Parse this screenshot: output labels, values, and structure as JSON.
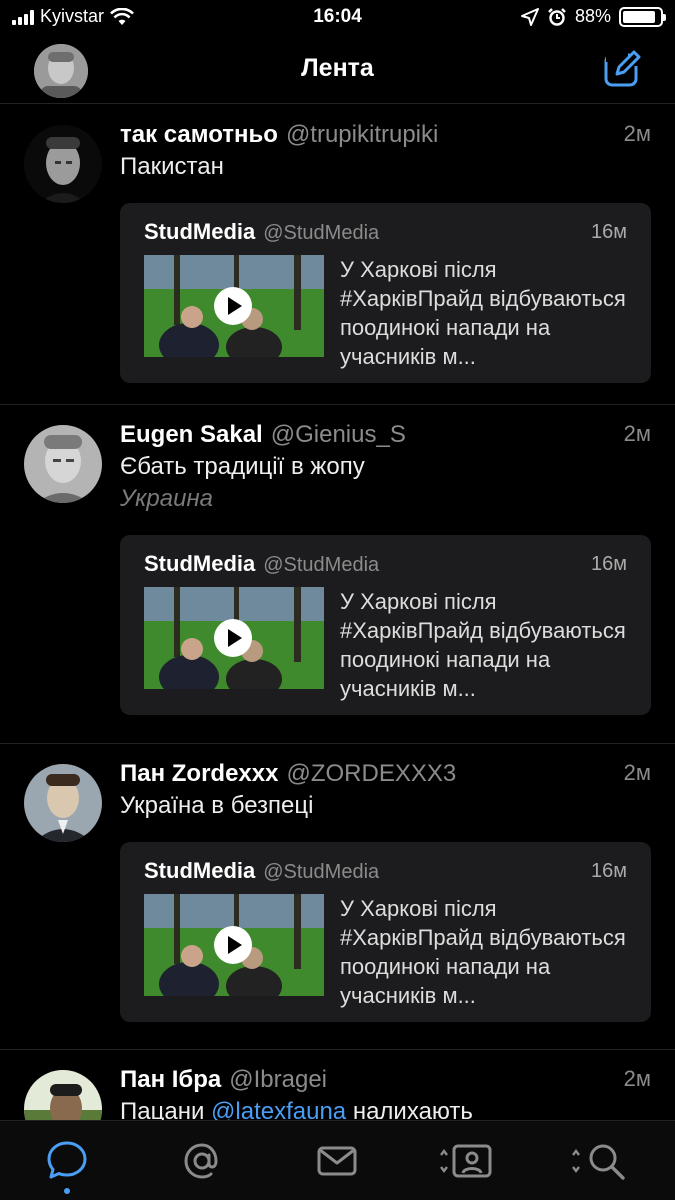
{
  "status_bar": {
    "carrier": "Kyivstar",
    "time": "16:04",
    "battery": "88%",
    "battery_level": 0.88
  },
  "nav": {
    "title": "Лента"
  },
  "tweets": [
    {
      "name": "так самотньо",
      "handle": "@trupikitrupiki",
      "time": "2м",
      "text": "Пакистан",
      "quote": {
        "name": "StudMedia",
        "handle": "@StudMedia",
        "time": "16м",
        "text": "У Харкові після #ХарківПрайд відбуваються поодинокі напади на учасників м..."
      }
    },
    {
      "name": "Eugen Sakal",
      "handle": "@Gienius_S",
      "time": "2м",
      "text": "Єбать традиції в жопу",
      "location": "Украина",
      "quote": {
        "name": "StudMedia",
        "handle": "@StudMedia",
        "time": "16м",
        "text": "У Харкові після #ХарківПрайд відбуваються поодинокі напади на учасників м..."
      }
    },
    {
      "name": "Пан Zordexxx",
      "handle": "@ZORDEXXX3",
      "time": "2м",
      "text": "Україна в безпеці",
      "quote": {
        "name": "StudMedia",
        "handle": "@StudMedia",
        "time": "16м",
        "text": "У Харкові після #ХарківПрайд відбуваються поодинокі напади на учасників м..."
      }
    },
    {
      "name": "Пан Ібра",
      "handle": "@Ibragei",
      "time": "2м",
      "text_before": "Пацани ",
      "mention": "@latexfauna",
      "text_after": " налихають"
    }
  ],
  "tab_bar": {
    "tabs": [
      "home-icon",
      "mentions-icon",
      "messages-icon",
      "accounts-icon",
      "search-icon"
    ],
    "active": 0
  },
  "colors": {
    "accent": "#4a9ff5",
    "background": "#000000",
    "card": "#1c1c1e",
    "muted": "#8b8b8b"
  }
}
